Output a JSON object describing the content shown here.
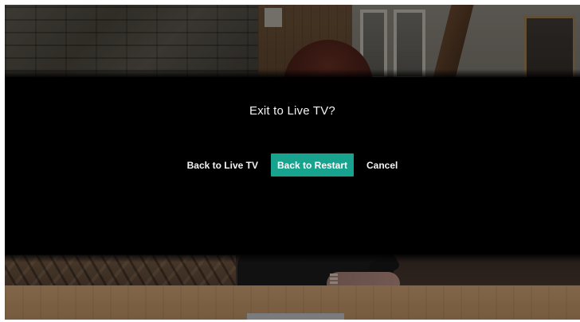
{
  "dialog": {
    "title": "Exit to Live TV?",
    "buttons": [
      {
        "label": "Back to Live TV",
        "focused": false
      },
      {
        "label": "Back to Restart",
        "focused": true
      },
      {
        "label": "Cancel",
        "focused": false
      }
    ]
  },
  "colors": {
    "focus_accent": "#18a38f",
    "overlay": "#000000",
    "text": "#f2f2f2"
  }
}
